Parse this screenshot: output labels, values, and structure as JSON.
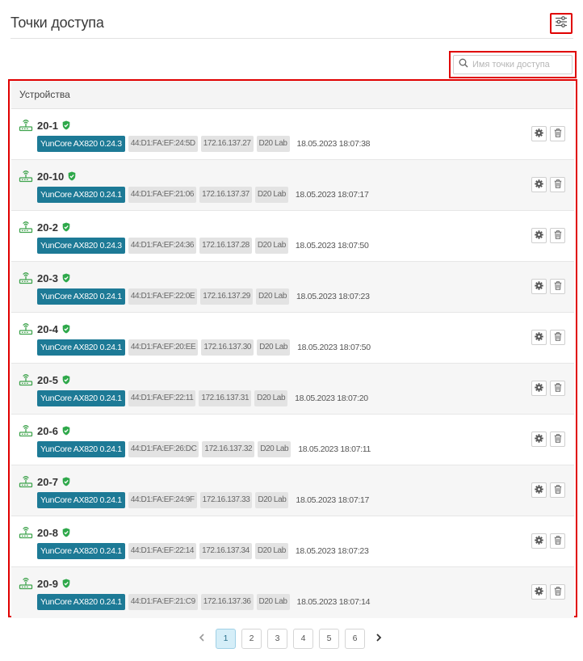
{
  "header": {
    "title": "Точки доступа"
  },
  "search": {
    "placeholder": "Имя точки доступа",
    "value": ""
  },
  "panel": {
    "title": "Устройства"
  },
  "devices": [
    {
      "name": "20-1",
      "model": "YunCore AX820 0.24.3",
      "mac": "44:D1:FA:EF:24:5D",
      "ip": "172.16.137.27",
      "location": "D20 Lab",
      "date": "18.05.2023 18:07:38"
    },
    {
      "name": "20-10",
      "model": "YunCore AX820 0.24.1",
      "mac": "44:D1:FA:EF:21:06",
      "ip": "172.16.137.37",
      "location": "D20 Lab",
      "date": "18.05.2023 18:07:17"
    },
    {
      "name": "20-2",
      "model": "YunCore AX820 0.24.3",
      "mac": "44:D1:FA:EF:24:36",
      "ip": "172.16.137.28",
      "location": "D20 Lab",
      "date": "18.05.2023 18:07:50"
    },
    {
      "name": "20-3",
      "model": "YunCore AX820 0.24.1",
      "mac": "44:D1:FA:EF:22:0E",
      "ip": "172.16.137.29",
      "location": "D20 Lab",
      "date": "18.05.2023 18:07:23"
    },
    {
      "name": "20-4",
      "model": "YunCore AX820 0.24.1",
      "mac": "44:D1:FA:EF:20:EE",
      "ip": "172.16.137.30",
      "location": "D20 Lab",
      "date": "18.05.2023 18:07:50"
    },
    {
      "name": "20-5",
      "model": "YunCore AX820 0.24.1",
      "mac": "44:D1:FA:EF:22:11",
      "ip": "172.16.137.31",
      "location": "D20 Lab",
      "date": "18.05.2023 18:07:20"
    },
    {
      "name": "20-6",
      "model": "YunCore AX820 0.24.1",
      "mac": "44:D1:FA:EF:26:DC",
      "ip": "172.16.137.32",
      "location": "D20 Lab",
      "date": "18.05.2023 18:07:11"
    },
    {
      "name": "20-7",
      "model": "YunCore AX820 0.24.1",
      "mac": "44:D1:FA:EF:24:9F",
      "ip": "172.16.137.33",
      "location": "D20 Lab",
      "date": "18.05.2023 18:07:17"
    },
    {
      "name": "20-8",
      "model": "YunCore AX820 0.24.1",
      "mac": "44:D1:FA:EF:22:14",
      "ip": "172.16.137.34",
      "location": "D20 Lab",
      "date": "18.05.2023 18:07:23"
    },
    {
      "name": "20-9",
      "model": "YunCore AX820 0.24.1",
      "mac": "44:D1:FA:EF:21:C9",
      "ip": "172.16.137.36",
      "location": "D20 Lab",
      "date": "18.05.2023 18:07:14"
    }
  ],
  "icons": {
    "settings": "sliders-icon",
    "search": "search-icon",
    "device": "wifi-router-icon",
    "status": "shield-check-icon",
    "edit": "gear-icon",
    "delete": "trash-icon",
    "prev": "chevron-left-icon",
    "next": "chevron-right-icon"
  },
  "colors": {
    "accent": "#1d7a96",
    "status_ok": "#2ea84a",
    "router_icon": "#3fa34d",
    "highlight_border": "#e00000",
    "active_page_bg": "#d5eef8"
  },
  "pagination": {
    "pages": [
      "1",
      "2",
      "3",
      "4",
      "5",
      "6"
    ],
    "current": "1"
  }
}
